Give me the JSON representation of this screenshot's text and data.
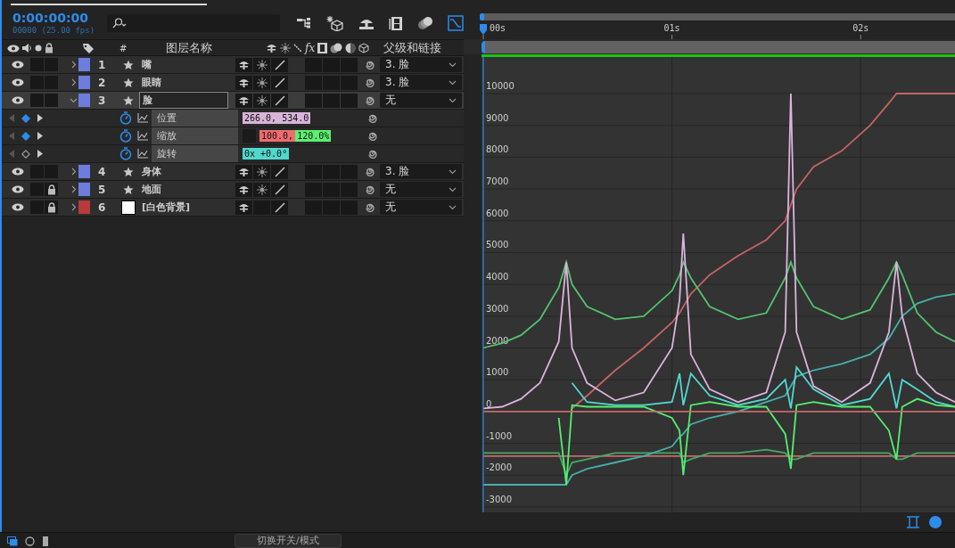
{
  "time": {
    "current": "0:00:00:00",
    "frames": "00000 (25.00 fps)"
  },
  "toolbar": [
    {
      "kind": "flowchart",
      "selected": false
    },
    {
      "kind": "sparkle-cube",
      "selected": false
    },
    {
      "kind": "draft-3d",
      "selected": false
    },
    {
      "kind": "film",
      "selected": false
    },
    {
      "kind": "motion-blur",
      "selected": false
    },
    {
      "kind": "graph-editor",
      "selected": true
    }
  ],
  "columns": {
    "number": "#",
    "layer_name": "图层名称",
    "effects": "fx",
    "parent": "父级和链接"
  },
  "layers": [
    {
      "number": "1",
      "name": "嘴",
      "kind": "shape",
      "color": "#6b7ee0",
      "expanded": false,
      "selected": false,
      "locked": false,
      "collapse_switch": true,
      "parent": "3. 脸"
    },
    {
      "number": "2",
      "name": "眼睛",
      "kind": "shape",
      "color": "#6b7ee0",
      "expanded": false,
      "selected": false,
      "locked": false,
      "collapse_switch": true,
      "parent": "3. 脸"
    },
    {
      "number": "3",
      "name": "脸",
      "kind": "shape",
      "color": "#6b7ee0",
      "expanded": true,
      "selected": true,
      "locked": false,
      "collapse_switch": true,
      "parent": "无",
      "properties": [
        {
          "name": "位置",
          "keyframe": true,
          "constrain": false,
          "segments": [
            {
              "text": "266.0, 534.0",
              "color": "#d8b4d8"
            }
          ]
        },
        {
          "name": "缩放",
          "keyframe": true,
          "constrain": true,
          "segments": [
            {
              "text": "100.0,",
              "color": "#f06c6c"
            },
            {
              "text": "120.0%",
              "color": "#5cf070"
            }
          ]
        },
        {
          "name": "旋转",
          "keyframe": false,
          "constrain": false,
          "segments": [
            {
              "text": "0x +0.0°",
              "color": "#50d8cc"
            }
          ]
        }
      ]
    },
    {
      "number": "4",
      "name": "身体",
      "kind": "shape",
      "color": "#6b7ee0",
      "expanded": false,
      "selected": false,
      "locked": false,
      "collapse_switch": true,
      "parent": "3. 脸"
    },
    {
      "number": "5",
      "name": "地面",
      "kind": "shape",
      "color": "#6b7ee0",
      "expanded": false,
      "selected": false,
      "locked": true,
      "collapse_switch": true,
      "parent": "无"
    },
    {
      "number": "6",
      "name": "[白色背景]",
      "kind": "solid",
      "color": "#b83a3a",
      "expanded": false,
      "selected": false,
      "locked": true,
      "collapse_switch": false,
      "parent": "无"
    }
  ],
  "graph": {
    "chart_data": {
      "type": "line",
      "x": [
        0,
        0.1,
        0.2,
        0.3,
        0.4,
        0.44,
        0.47,
        0.55,
        0.7,
        0.85,
        1.0,
        1.04,
        1.06,
        1.1,
        1.2,
        1.35,
        1.5,
        1.6,
        1.63,
        1.66,
        1.75,
        1.9,
        2.05,
        2.15,
        2.19,
        2.22,
        2.3,
        2.4,
        2.5
      ],
      "grid": true,
      "xlim": [
        0,
        2.5
      ],
      "ylim": [
        -3170,
        11150
      ],
      "xticks": [
        {
          "value": 0,
          "label": "00s"
        },
        {
          "value": 1,
          "label": "01s"
        },
        {
          "value": 2,
          "label": "02s"
        }
      ],
      "yticks": [
        {
          "value": 10000,
          "label": "10000"
        },
        {
          "value": 9000,
          "label": "9000"
        },
        {
          "value": 8000,
          "label": "8000"
        },
        {
          "value": 7000,
          "label": "7000"
        },
        {
          "value": 6000,
          "label": "6000"
        },
        {
          "value": 5000,
          "label": "5000"
        },
        {
          "value": 4000,
          "label": "4000"
        },
        {
          "value": 3000,
          "label": "3000"
        },
        {
          "value": 2000,
          "label": "2000"
        },
        {
          "value": 1000,
          "label": "1000"
        },
        {
          "value": 0,
          "label": "0"
        },
        {
          "value": -1000,
          "label": "-1000"
        },
        {
          "value": -2000,
          "label": "-2000"
        },
        {
          "value": -3000,
          "label": "-3000"
        }
      ],
      "series": [
        {
          "color": "#c86a6a",
          "values": [
            -1400,
            -1400,
            -1400,
            -1400,
            -1400,
            -1400,
            -1400,
            -1400,
            -1400,
            -1400,
            -1400,
            -1400,
            -1400,
            -1400,
            -1400,
            -1400,
            -1400,
            -1400,
            -1400,
            -1400,
            -1400,
            -1400,
            -1400,
            -1400,
            -1400,
            -1400,
            -1400,
            -1400,
            -1400
          ]
        },
        {
          "color": "#c46464",
          "values": [
            null,
            null,
            null,
            null,
            null,
            null,
            100,
            500,
            1300,
            2000,
            2800,
            3100,
            3300,
            3700,
            4300,
            4900,
            5400,
            6000,
            6500,
            7000,
            7700,
            8200,
            9000,
            9700,
            10000,
            10000,
            10000,
            10000,
            10000
          ]
        },
        {
          "color": "#46a862",
          "values": [
            -1300,
            -1300,
            -1300,
            -1300,
            -1300,
            -2000,
            -1600,
            -1500,
            -1300,
            -1300,
            -1300,
            -1300,
            -1600,
            -1500,
            -1300,
            -1300,
            -1200,
            -1300,
            -1500,
            -1500,
            -1300,
            -1300,
            -1300,
            -1300,
            -1500,
            -1500,
            -1300,
            -1300,
            -1300
          ]
        },
        {
          "color": "#44b0a8",
          "values": [
            -2300,
            -2300,
            -2300,
            -2300,
            -2300,
            -2300,
            -2000,
            -1800,
            -1600,
            -1400,
            -1100,
            -800,
            -700,
            -400,
            -200,
            0,
            300,
            500,
            800,
            1100,
            1300,
            1500,
            1800,
            2300,
            2700,
            3000,
            3400,
            3600,
            3700
          ]
        },
        {
          "color": "#52c46e",
          "values": [
            2000,
            2150,
            2400,
            2900,
            3900,
            4700,
            4000,
            3300,
            2900,
            3000,
            3800,
            4300,
            4700,
            4200,
            3300,
            2900,
            3100,
            4200,
            4700,
            4200,
            3300,
            2900,
            3200,
            4200,
            4700,
            4300,
            3100,
            2500,
            2200
          ]
        },
        {
          "color": "#dcb4dc",
          "values": [
            100,
            150,
            400,
            900,
            2200,
            4700,
            2000,
            900,
            350,
            600,
            2000,
            3500,
            5600,
            1800,
            700,
            300,
            600,
            2500,
            10000,
            2500,
            800,
            300,
            900,
            2500,
            4700,
            3000,
            1200,
            600,
            300
          ]
        },
        {
          "color": "#52d8d0",
          "values": [
            null,
            null,
            null,
            null,
            null,
            null,
            900,
            300,
            200,
            200,
            300,
            1200,
            200,
            1200,
            500,
            200,
            400,
            1000,
            100,
            1400,
            700,
            200,
            400,
            1200,
            100,
            1000,
            700,
            300,
            150
          ]
        },
        {
          "color": "#54f070",
          "values": [
            null,
            null,
            null,
            null,
            -200,
            -2300,
            200,
            150,
            150,
            150,
            -200,
            -600,
            -2000,
            200,
            300,
            150,
            150,
            -700,
            -1800,
            200,
            300,
            150,
            150,
            -600,
            -1500,
            150,
            400,
            200,
            150
          ]
        },
        {
          "color": "#c86a6a",
          "values": [
            0,
            0,
            0,
            0,
            0,
            0,
            0,
            0,
            0,
            0,
            0,
            0,
            0,
            0,
            0,
            0,
            0,
            0,
            0,
            0,
            0,
            0,
            0,
            0,
            0,
            0,
            0,
            0,
            0
          ]
        }
      ]
    }
  },
  "bottom": {
    "toggle_button": "切换开关/模式"
  }
}
